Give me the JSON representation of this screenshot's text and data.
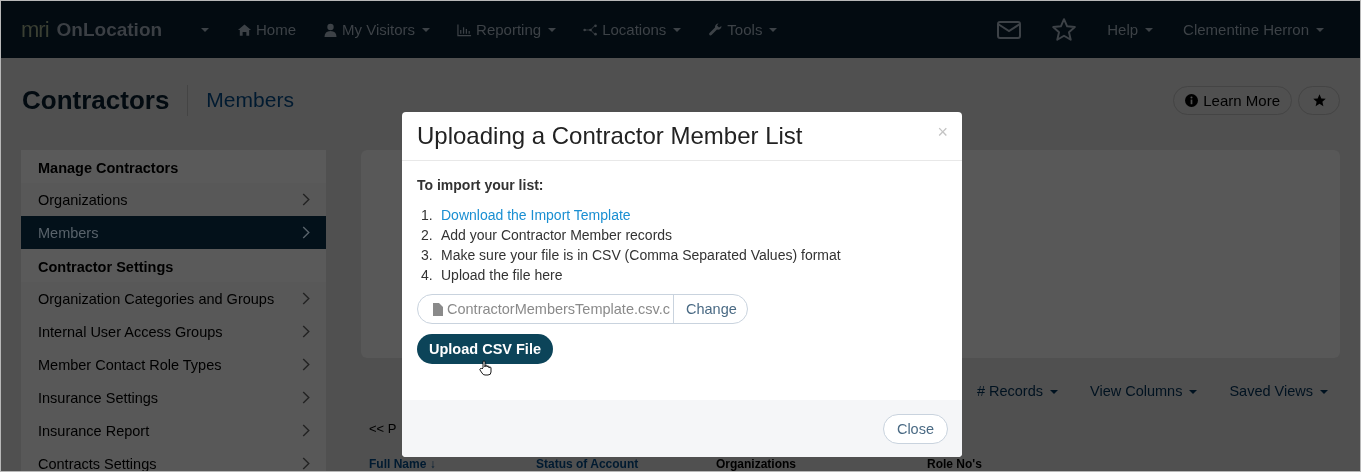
{
  "navbar": {
    "logo": "mri",
    "app_name": "OnLocation",
    "menu": [
      {
        "label": "Home",
        "dropdown": false
      },
      {
        "label": "My Visitors",
        "dropdown": true
      },
      {
        "label": "Reporting",
        "dropdown": true
      },
      {
        "label": "Locations",
        "dropdown": true
      },
      {
        "label": "Tools",
        "dropdown": true
      }
    ],
    "right_menu": [
      {
        "label": "Help",
        "dropdown": true
      },
      {
        "label": "Clementine Herron",
        "dropdown": true
      }
    ]
  },
  "page": {
    "title": "Contractors",
    "subtitle": "Members",
    "learn_more": "Learn More"
  },
  "sidebar": [
    {
      "title": "Manage Contractors",
      "items": [
        {
          "label": "Organizations",
          "selected": false
        },
        {
          "label": "Members",
          "selected": true
        }
      ]
    },
    {
      "title": "Contractor Settings",
      "items": [
        {
          "label": "Organization Categories and Groups",
          "selected": false
        },
        {
          "label": "Internal User Access Groups",
          "selected": false
        },
        {
          "label": "Member Contact Role Types",
          "selected": false
        },
        {
          "label": "Insurance Settings",
          "selected": false
        },
        {
          "label": "Insurance Report",
          "selected": false
        },
        {
          "label": "Contracts Settings",
          "selected": false
        }
      ]
    }
  ],
  "toolbar": [
    "# Records",
    "View Columns",
    "Saved Views"
  ],
  "pager": "<< P",
  "table": {
    "columns": [
      "Full Name ↓",
      "Status of Account",
      "Organizations",
      "Role No's"
    ]
  },
  "modal": {
    "title": "Uploading a Contractor Member List",
    "close_symbol": "×",
    "intro": "To import your list:",
    "steps": [
      {
        "number": "1.",
        "text": "Download the Import Template",
        "kind": "link"
      },
      {
        "number": "2.",
        "text": "Add your Contractor Member records",
        "kind": "text"
      },
      {
        "number": "3.",
        "text": "Make sure your file is in CSV (Comma Separated Values) format",
        "kind": "text"
      },
      {
        "number": "4.",
        "text": "Upload the file here",
        "kind": "text"
      }
    ],
    "file_value": "ContractorMembersTemplate.csv.c",
    "change_button": "Change",
    "upload_button": "Upload CSV File",
    "footer_button": "Close"
  }
}
